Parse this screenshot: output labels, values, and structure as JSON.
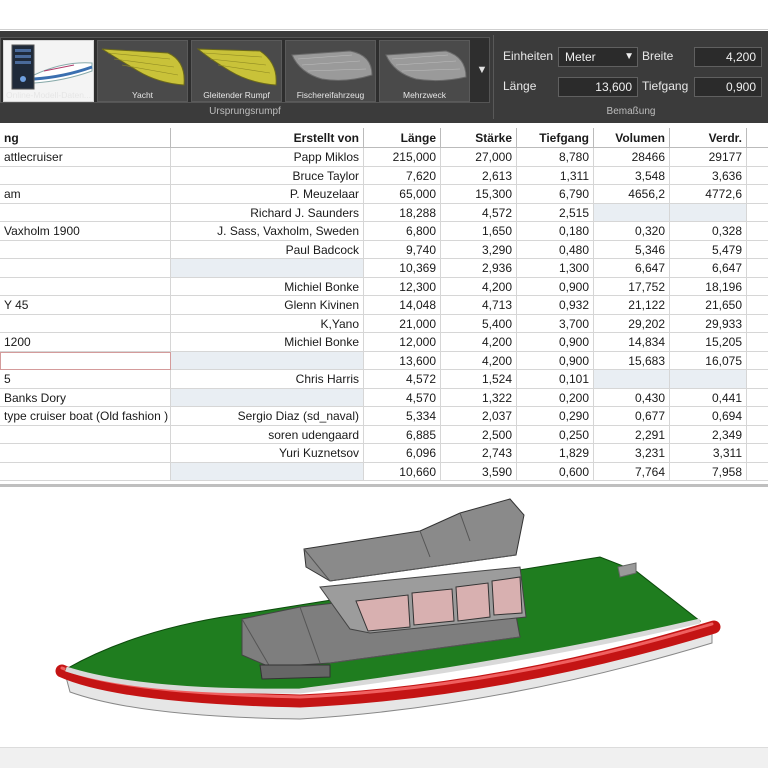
{
  "ribbon": {
    "gallery": [
      {
        "caption": "Online-Modell-Daten...",
        "icon": "server-icon",
        "selected": true
      },
      {
        "caption": "Yacht",
        "icon": "yacht-hull-icon",
        "selected": false
      },
      {
        "caption": "Gleitender Rumpf",
        "icon": "planing-hull-icon",
        "selected": false
      },
      {
        "caption": "Fischereifahrzeug",
        "icon": "fishing-vessel-hull-icon",
        "selected": false
      },
      {
        "caption": "Mehrzweck",
        "icon": "multipurpose-hull-icon",
        "selected": false
      }
    ],
    "gallery_group_label": "Ursprungsrumpf",
    "dimensions_group_label": "Bemaßung",
    "units_label": "Einheiten",
    "units_value": "Meter",
    "width_label": "Breite",
    "width_value": "4,200",
    "length_label": "Länge",
    "length_value": "13,600",
    "draft_label": "Tiefgang",
    "draft_value": "0,900"
  },
  "table": {
    "headers": [
      "ng",
      "Erstellt von",
      "Länge",
      "Stärke",
      "Tiefgang",
      "Volumen",
      "Verdr."
    ],
    "rows": [
      [
        "attlecruiser",
        "Papp Miklos",
        "215,000",
        "27,000",
        "8,780",
        "28466",
        "29177"
      ],
      [
        "",
        "Bruce Taylor",
        "7,620",
        "2,613",
        "1,311",
        "3,548",
        "3,636"
      ],
      [
        "am",
        "P. Meuzelaar",
        "65,000",
        "15,300",
        "6,790",
        "4656,2",
        "4772,6"
      ],
      [
        "",
        "Richard J. Saunders",
        "18,288",
        "4,572",
        "2,515",
        "",
        ""
      ],
      [
        "Vaxholm 1900",
        "J. Sass, Vaxholm, Sweden",
        "6,800",
        "1,650",
        "0,180",
        "0,320",
        "0,328"
      ],
      [
        "",
        "Paul Badcock",
        "9,740",
        "3,290",
        "0,480",
        "5,346",
        "5,479"
      ],
      [
        "",
        "",
        "10,369",
        "2,936",
        "1,300",
        "6,647",
        "6,647"
      ],
      [
        "",
        "Michiel Bonke",
        "12,300",
        "4,200",
        "0,900",
        "17,752",
        "18,196"
      ],
      [
        "Y 45",
        "Glenn Kivinen",
        "14,048",
        "4,713",
        "0,932",
        "21,122",
        "21,650"
      ],
      [
        "",
        "K,Yano",
        "21,000",
        "5,400",
        "3,700",
        "29,202",
        "29,933"
      ],
      [
        "1200",
        "Michiel Bonke",
        "12,000",
        "4,200",
        "0,900",
        "14,834",
        "15,205"
      ],
      [
        "",
        "",
        "13,600",
        "4,200",
        "0,900",
        "15,683",
        "16,075"
      ],
      [
        "5",
        "Chris Harris",
        "4,572",
        "1,524",
        "0,101",
        "",
        ""
      ],
      [
        "Banks Dory",
        "",
        "4,570",
        "1,322",
        "0,200",
        "0,430",
        "0,441"
      ],
      [
        "type cruiser boat (Old fashion )",
        "Sergio Diaz (sd_naval)",
        "5,334",
        "2,037",
        "0,290",
        "0,677",
        "0,694"
      ],
      [
        "",
        "soren udengaard",
        "6,885",
        "2,500",
        "0,250",
        "2,291",
        "2,349"
      ],
      [
        "",
        "Yuri Kuznetsov",
        "6,096",
        "2,743",
        "1,829",
        "3,231",
        "3,311"
      ],
      [
        "",
        "",
        "10,660",
        "3,590",
        "0,600",
        "7,764",
        "7,958"
      ]
    ]
  },
  "colors": {
    "ribbon_bg": "#3b3b3b",
    "deck_green": "#1e7d1e",
    "hull_red": "#d11a1a",
    "cabin_gray": "#8c8c8c",
    "empty_cell": "#e9eef3"
  }
}
